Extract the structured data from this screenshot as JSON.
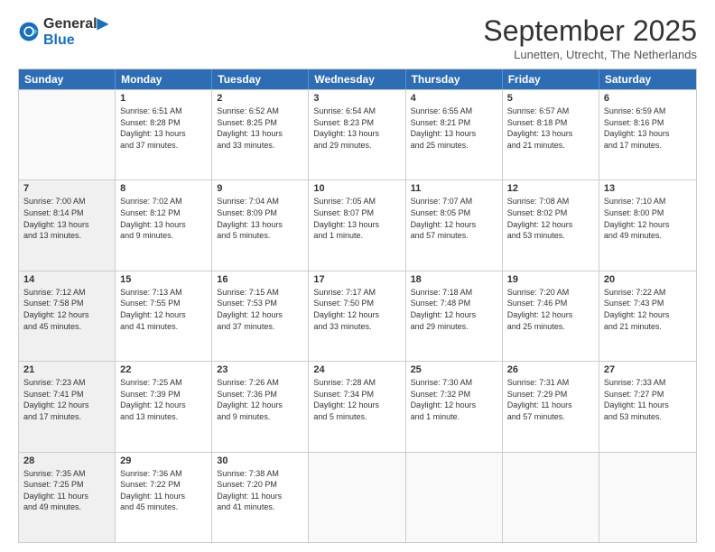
{
  "logo": {
    "line1": "General",
    "line2": "Blue"
  },
  "title": "September 2025",
  "location": "Lunetten, Utrecht, The Netherlands",
  "header_days": [
    "Sunday",
    "Monday",
    "Tuesday",
    "Wednesday",
    "Thursday",
    "Friday",
    "Saturday"
  ],
  "rows": [
    [
      {
        "day": "",
        "text": "",
        "empty": true
      },
      {
        "day": "1",
        "text": "Sunrise: 6:51 AM\nSunset: 8:28 PM\nDaylight: 13 hours\nand 37 minutes."
      },
      {
        "day": "2",
        "text": "Sunrise: 6:52 AM\nSunset: 8:25 PM\nDaylight: 13 hours\nand 33 minutes."
      },
      {
        "day": "3",
        "text": "Sunrise: 6:54 AM\nSunset: 8:23 PM\nDaylight: 13 hours\nand 29 minutes."
      },
      {
        "day": "4",
        "text": "Sunrise: 6:55 AM\nSunset: 8:21 PM\nDaylight: 13 hours\nand 25 minutes."
      },
      {
        "day": "5",
        "text": "Sunrise: 6:57 AM\nSunset: 8:18 PM\nDaylight: 13 hours\nand 21 minutes."
      },
      {
        "day": "6",
        "text": "Sunrise: 6:59 AM\nSunset: 8:16 PM\nDaylight: 13 hours\nand 17 minutes."
      }
    ],
    [
      {
        "day": "7",
        "text": "Sunrise: 7:00 AM\nSunset: 8:14 PM\nDaylight: 13 hours\nand 13 minutes.",
        "shaded": true
      },
      {
        "day": "8",
        "text": "Sunrise: 7:02 AM\nSunset: 8:12 PM\nDaylight: 13 hours\nand 9 minutes."
      },
      {
        "day": "9",
        "text": "Sunrise: 7:04 AM\nSunset: 8:09 PM\nDaylight: 13 hours\nand 5 minutes."
      },
      {
        "day": "10",
        "text": "Sunrise: 7:05 AM\nSunset: 8:07 PM\nDaylight: 13 hours\nand 1 minute."
      },
      {
        "day": "11",
        "text": "Sunrise: 7:07 AM\nSunset: 8:05 PM\nDaylight: 12 hours\nand 57 minutes."
      },
      {
        "day": "12",
        "text": "Sunrise: 7:08 AM\nSunset: 8:02 PM\nDaylight: 12 hours\nand 53 minutes."
      },
      {
        "day": "13",
        "text": "Sunrise: 7:10 AM\nSunset: 8:00 PM\nDaylight: 12 hours\nand 49 minutes."
      }
    ],
    [
      {
        "day": "14",
        "text": "Sunrise: 7:12 AM\nSunset: 7:58 PM\nDaylight: 12 hours\nand 45 minutes.",
        "shaded": true
      },
      {
        "day": "15",
        "text": "Sunrise: 7:13 AM\nSunset: 7:55 PM\nDaylight: 12 hours\nand 41 minutes."
      },
      {
        "day": "16",
        "text": "Sunrise: 7:15 AM\nSunset: 7:53 PM\nDaylight: 12 hours\nand 37 minutes."
      },
      {
        "day": "17",
        "text": "Sunrise: 7:17 AM\nSunset: 7:50 PM\nDaylight: 12 hours\nand 33 minutes."
      },
      {
        "day": "18",
        "text": "Sunrise: 7:18 AM\nSunset: 7:48 PM\nDaylight: 12 hours\nand 29 minutes."
      },
      {
        "day": "19",
        "text": "Sunrise: 7:20 AM\nSunset: 7:46 PM\nDaylight: 12 hours\nand 25 minutes."
      },
      {
        "day": "20",
        "text": "Sunrise: 7:22 AM\nSunset: 7:43 PM\nDaylight: 12 hours\nand 21 minutes."
      }
    ],
    [
      {
        "day": "21",
        "text": "Sunrise: 7:23 AM\nSunset: 7:41 PM\nDaylight: 12 hours\nand 17 minutes.",
        "shaded": true
      },
      {
        "day": "22",
        "text": "Sunrise: 7:25 AM\nSunset: 7:39 PM\nDaylight: 12 hours\nand 13 minutes."
      },
      {
        "day": "23",
        "text": "Sunrise: 7:26 AM\nSunset: 7:36 PM\nDaylight: 12 hours\nand 9 minutes."
      },
      {
        "day": "24",
        "text": "Sunrise: 7:28 AM\nSunset: 7:34 PM\nDaylight: 12 hours\nand 5 minutes."
      },
      {
        "day": "25",
        "text": "Sunrise: 7:30 AM\nSunset: 7:32 PM\nDaylight: 12 hours\nand 1 minute."
      },
      {
        "day": "26",
        "text": "Sunrise: 7:31 AM\nSunset: 7:29 PM\nDaylight: 11 hours\nand 57 minutes."
      },
      {
        "day": "27",
        "text": "Sunrise: 7:33 AM\nSunset: 7:27 PM\nDaylight: 11 hours\nand 53 minutes."
      }
    ],
    [
      {
        "day": "28",
        "text": "Sunrise: 7:35 AM\nSunset: 7:25 PM\nDaylight: 11 hours\nand 49 minutes.",
        "shaded": true
      },
      {
        "day": "29",
        "text": "Sunrise: 7:36 AM\nSunset: 7:22 PM\nDaylight: 11 hours\nand 45 minutes."
      },
      {
        "day": "30",
        "text": "Sunrise: 7:38 AM\nSunset: 7:20 PM\nDaylight: 11 hours\nand 41 minutes."
      },
      {
        "day": "",
        "text": "",
        "empty": true
      },
      {
        "day": "",
        "text": "",
        "empty": true
      },
      {
        "day": "",
        "text": "",
        "empty": true
      },
      {
        "day": "",
        "text": "",
        "empty": true
      }
    ]
  ]
}
